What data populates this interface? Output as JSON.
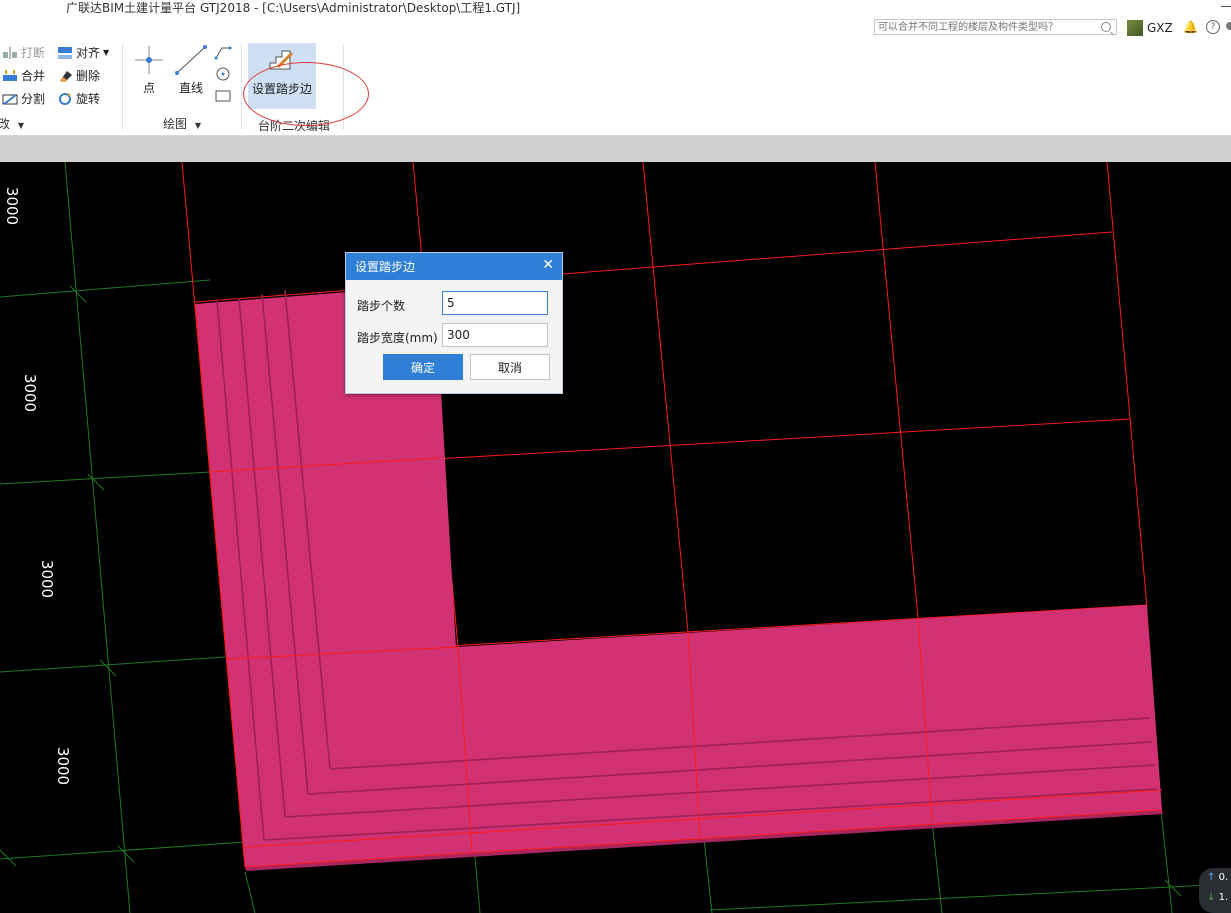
{
  "window": {
    "title": "广联达BIM土建计量平台 GTJ2018 - [C:\\Users\\Administrator\\Desktop\\工程1.GTJ]"
  },
  "search": {
    "placeholder": "可以合并不同工程的楼层及构件类型吗？"
  },
  "user": {
    "name": "GXZ"
  },
  "ribbon": {
    "modify": {
      "items": [
        "打断",
        "对齐",
        "合并",
        "删除",
        "分割",
        "旋转"
      ],
      "group_label": "改"
    },
    "draw": {
      "point_label": "点",
      "line_label": "直线",
      "group_label": "绘图"
    },
    "step_edit": {
      "set_step_label": "设置踏步边",
      "group_label": "台阶二次编辑"
    }
  },
  "canvas": {
    "dimensions": [
      "3000",
      "3000",
      "3000",
      "3000"
    ]
  },
  "dialog": {
    "title": "设置踏步边",
    "fields": [
      {
        "label": "踏步个数",
        "value": "5"
      },
      {
        "label": "踏步宽度(mm)",
        "value": "300"
      }
    ],
    "ok_label": "确定",
    "cancel_label": "取消"
  },
  "mini_panel": {
    "line1": "0.",
    "line2": "1."
  },
  "colors": {
    "accent": "#2f7fd7",
    "step_fill": "#d23274",
    "grid_red": "#ff1a1a",
    "grid_green": "#1f7a1f"
  }
}
